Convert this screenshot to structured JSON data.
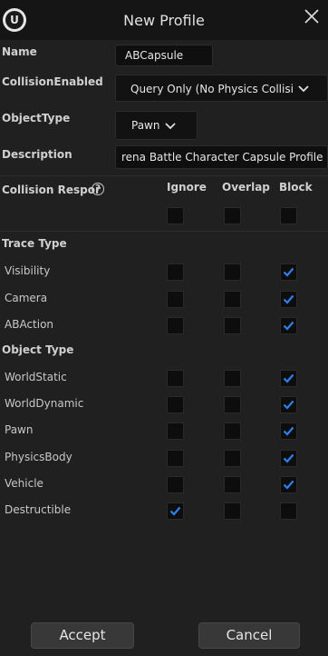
{
  "window": {
    "title": "New Profile"
  },
  "form": {
    "name_label": "Name",
    "name_value": "ABCapsule",
    "collision_label": "CollisionEnabled",
    "collision_value": "Query Only (No Physics Collisic",
    "object_type_label": "ObjectType",
    "object_type_value": "Pawn",
    "description_label": "Description",
    "description_value": "rena Battle Character Capsule Profile"
  },
  "responses": {
    "header_label": "Collision Respor",
    "col_ignore": "Ignore",
    "col_overlap": "Overlap",
    "col_block": "Block",
    "trace_section": "Trace Type",
    "object_section": "Object Type",
    "trace_rows": [
      {
        "label": "Visibility",
        "ignore": false,
        "overlap": false,
        "block": true
      },
      {
        "label": "Camera",
        "ignore": false,
        "overlap": false,
        "block": true
      },
      {
        "label": "ABAction",
        "ignore": false,
        "overlap": false,
        "block": true
      }
    ],
    "object_rows": [
      {
        "label": "WorldStatic",
        "ignore": false,
        "overlap": false,
        "block": true
      },
      {
        "label": "WorldDynamic",
        "ignore": false,
        "overlap": false,
        "block": true
      },
      {
        "label": "Pawn",
        "ignore": false,
        "overlap": false,
        "block": true
      },
      {
        "label": "PhysicsBody",
        "ignore": false,
        "overlap": false,
        "block": true
      },
      {
        "label": "Vehicle",
        "ignore": false,
        "overlap": false,
        "block": true
      },
      {
        "label": "Destructible",
        "ignore": true,
        "overlap": false,
        "block": false
      }
    ]
  },
  "buttons": {
    "accept": "Accept",
    "cancel": "Cancel"
  },
  "icons": {
    "logo": "unreal-logo-icon",
    "close": "close-icon",
    "help": "help-icon",
    "check": "checkmark-icon"
  },
  "colors": {
    "check": "#2f80ed",
    "background": "#202020",
    "titlebar": "#151515"
  }
}
